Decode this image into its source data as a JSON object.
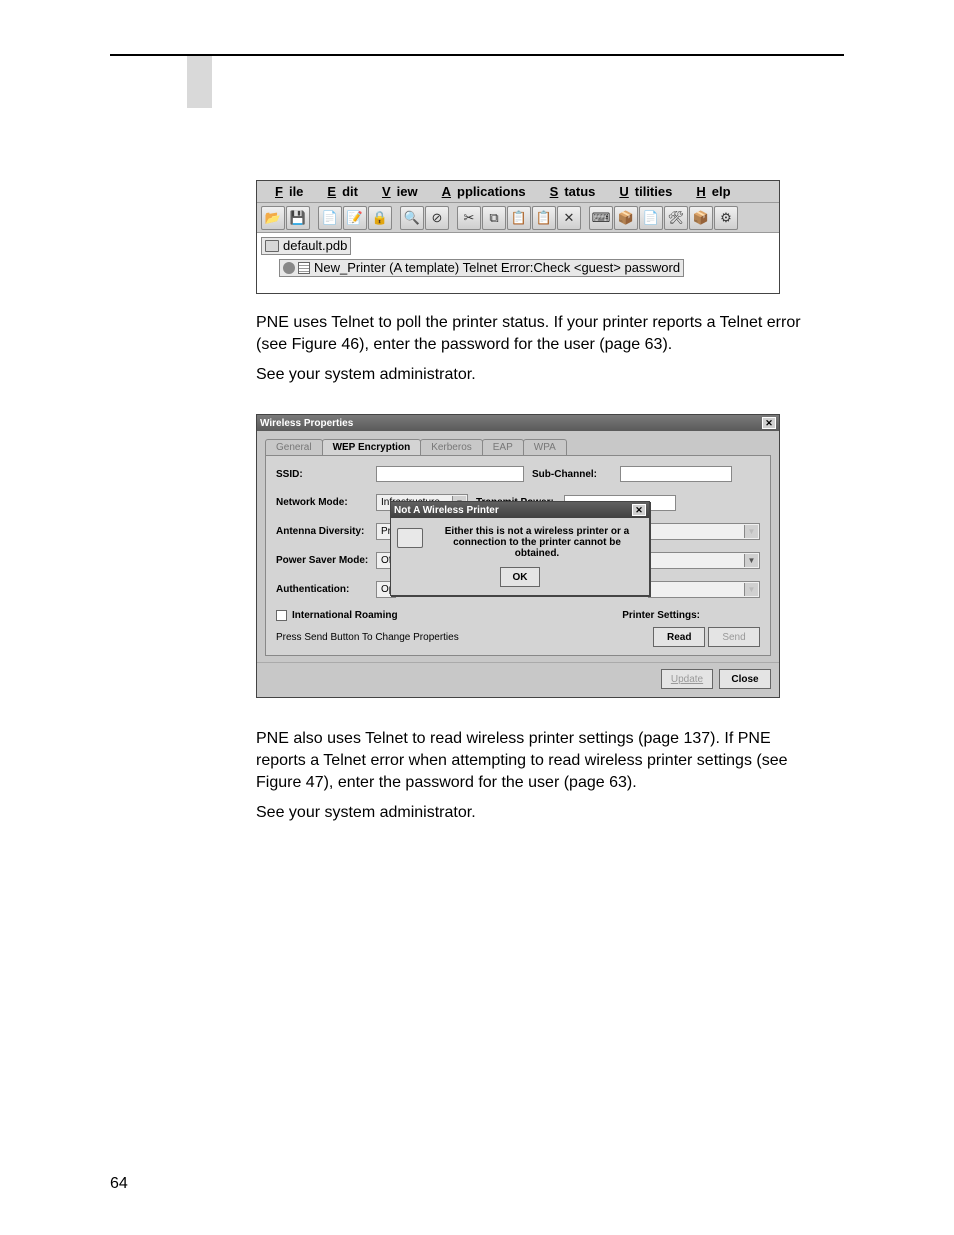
{
  "page_number": "64",
  "fig46": {
    "menus": [
      "File",
      "Edit",
      "View",
      "Applications",
      "Status",
      "Utilities",
      "Help"
    ],
    "toolbar_icons": [
      "open-icon",
      "save-icon",
      "new-doc-icon",
      "edit-doc-icon",
      "lock-doc-icon",
      "search-icon",
      "stop-icon",
      "cut-icon",
      "copy-icon",
      "paste-icon",
      "paste2-icon",
      "delete-icon",
      "keyboard-icon",
      "box-icon",
      "note-icon",
      "tool-icon",
      "wizard-icon",
      "props-icon"
    ],
    "root_node": "default.pdb",
    "child_node": "New_Printer (A template) Telnet Error:Check <guest> password"
  },
  "para1a": "PNE uses Telnet to poll the printer status. If your printer reports a Telnet error (see Figure 46), enter the password for the user ",
  "para1b": " (page 63).",
  "para2": "See your system administrator.",
  "fig47": {
    "title": "Wireless Properties",
    "tabs": [
      "General",
      "WEP Encryption",
      "Kerberos",
      "EAP",
      "WPA"
    ],
    "labels": {
      "ssid": "SSID:",
      "subchannel": "Sub-Channel:",
      "network_mode": "Network Mode:",
      "network_mode_val": "Infrastructure",
      "transmit_power": "Transmit Power:",
      "antenna": "Antenna Diversity:",
      "antenna_val": "Pri",
      "psm": "Power Saver Mode:",
      "psm_val": "Off",
      "auth": "Authentication:",
      "auth_val": "Op",
      "roaming": "International Roaming",
      "printer_settings": "Printer Settings:",
      "hint": "Press Send Button To Change Properties",
      "read": "Read",
      "send": "Send",
      "update": "Update",
      "close": "Close"
    },
    "modal": {
      "title": "Not A Wireless Printer",
      "line1": "Either this is not a wireless printer or a",
      "line2": "connection to the printer cannot be obtained.",
      "ok": "OK"
    }
  },
  "para3a": "PNE also uses Telnet to read wireless printer settings (page 137). If PNE reports a Telnet error when attempting to read wireless printer settings (see Figure 47), enter the password for the user ",
  "para3b": " (page 63).",
  "para4": "See your system administrator."
}
